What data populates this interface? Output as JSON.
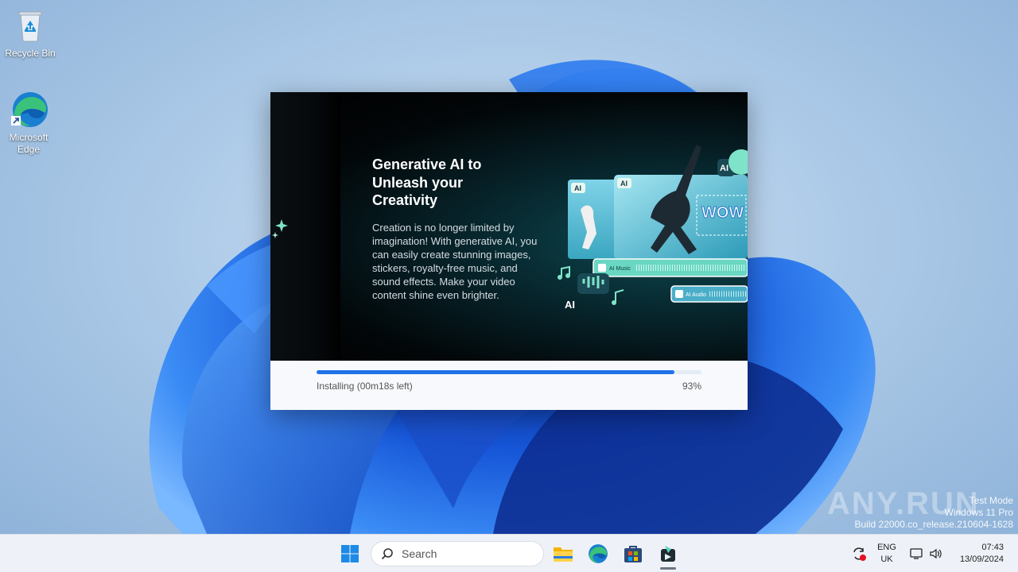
{
  "desktop": {
    "icons": [
      {
        "label": "Recycle Bin",
        "icon": "recycle-bin-icon"
      },
      {
        "label": "Microsoft\nEdge",
        "icon": "edge-icon"
      }
    ]
  },
  "installer": {
    "hero": {
      "title": "Generative AI to Unleash your Creativity",
      "description": "Creation is no longer limited by imagination! With generative AI, you can easily create stunning images, stickers, royalty-free music, and sound effects. Make your video content shine even brighter.",
      "badges": {
        "ai": "AI",
        "wow": "WOW",
        "ai_music": "AI Music",
        "ai_audio": "AI Audio"
      }
    },
    "progress": {
      "status": "Installing (00m18s left)",
      "percent_label": "93%",
      "fraction": 0.93,
      "accent_color": "#1f72e8"
    }
  },
  "watermark": {
    "brand": "ANY.RUN",
    "line1": "Test Mode",
    "line2": "Windows 11 Pro",
    "line3": "Build 22000.co_release.210604-1628"
  },
  "taskbar": {
    "search_placeholder": "Search",
    "apps": [
      "start-icon",
      "file-explorer-icon",
      "edge-icon",
      "store-icon",
      "installer-app-icon"
    ],
    "tray": {
      "language_line1": "ENG",
      "language_line2": "UK",
      "time": "07:43",
      "date": "13/09/2024"
    }
  }
}
